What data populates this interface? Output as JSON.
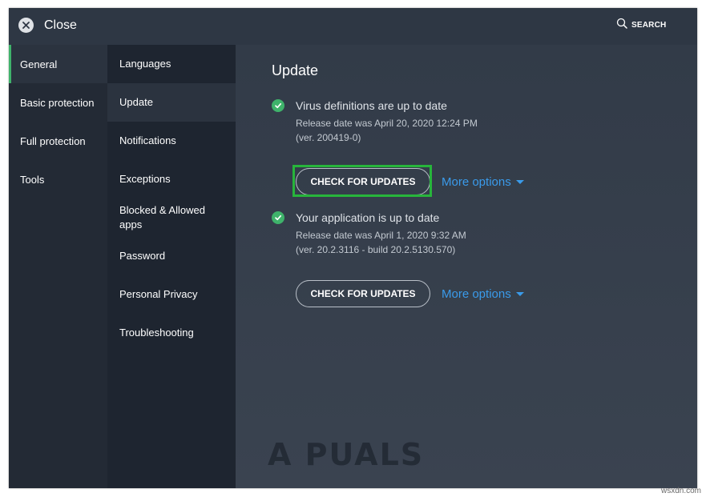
{
  "header": {
    "close_label": "Close",
    "close_icon": "close-icon",
    "search_label": "SEARCH",
    "search_icon": "search-icon"
  },
  "nav_primary": {
    "items": [
      {
        "label": "General",
        "active": true
      },
      {
        "label": "Basic protection",
        "active": false
      },
      {
        "label": "Full protection",
        "active": false
      },
      {
        "label": "Tools",
        "active": false
      }
    ]
  },
  "nav_secondary": {
    "items": [
      {
        "label": "Languages",
        "active": false
      },
      {
        "label": "Update",
        "active": true
      },
      {
        "label": "Notifications",
        "active": false
      },
      {
        "label": "Exceptions",
        "active": false
      },
      {
        "label": "Blocked & Allowed apps",
        "active": false
      },
      {
        "label": "Password",
        "active": false
      },
      {
        "label": "Personal Privacy",
        "active": false
      },
      {
        "label": "Troubleshooting",
        "active": false
      }
    ]
  },
  "main": {
    "title": "Update",
    "sections": [
      {
        "status": "Virus definitions are up to date",
        "release": "Release date was April 20, 2020 12:24 PM",
        "version": "(ver. 200419-0)",
        "button": "CHECK FOR UPDATES",
        "more_options": "More options",
        "highlighted": true
      },
      {
        "status": "Your application is up to date",
        "release": "Release date was April 1, 2020 9:32 AM",
        "version": "(ver. 20.2.3116 - build 20.2.5130.570)",
        "button": "CHECK FOR UPDATES",
        "more_options": "More options",
        "highlighted": false
      }
    ]
  },
  "watermark": "A PUALS",
  "credit": "wsxdn.com",
  "colors": {
    "accent_green": "#3fb36b",
    "link_blue": "#3a9bea",
    "highlight_green": "#27b53b",
    "panel_bg": "#2e3744"
  }
}
